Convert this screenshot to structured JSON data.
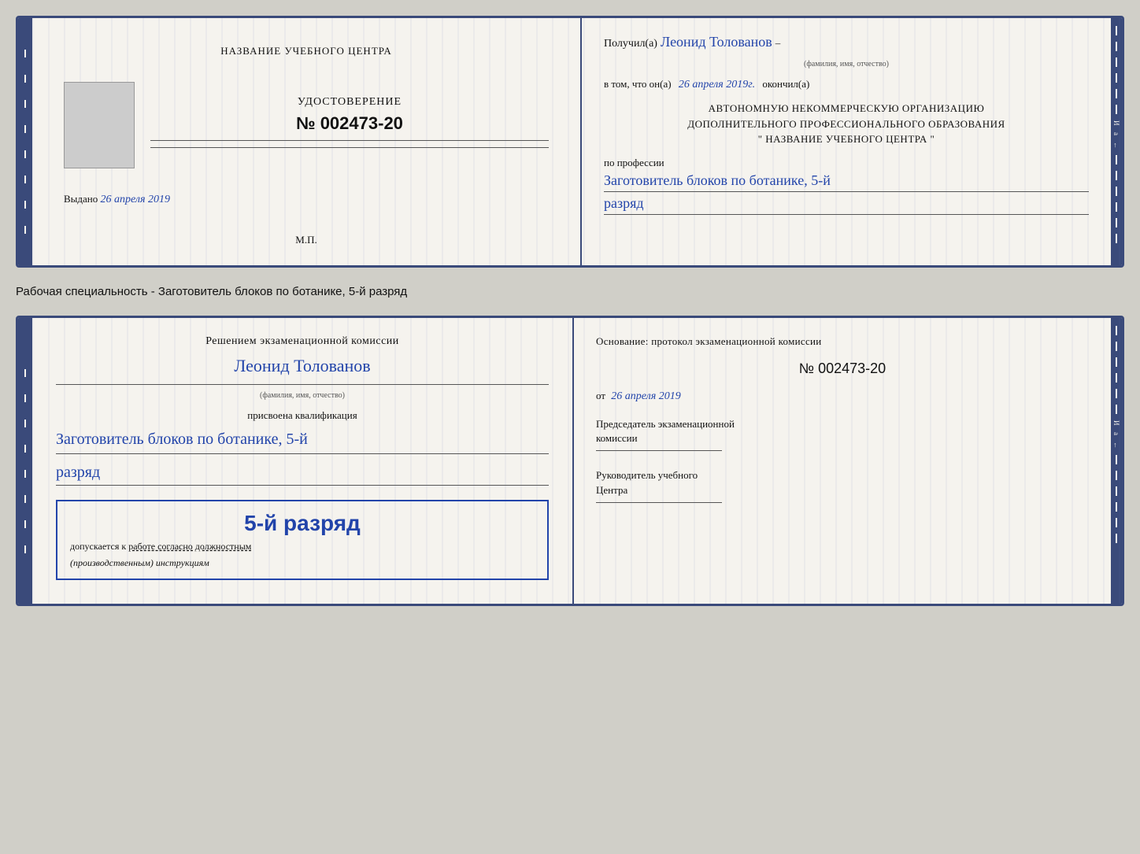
{
  "page": {
    "background_color": "#d0cfc8"
  },
  "top_card": {
    "left": {
      "title": "НАЗВАНИЕ УЧЕБНОГО ЦЕНТРА",
      "udostoverenie_label": "УДОСТОВЕРЕНИЕ",
      "number": "№ 002473-20",
      "vydano_prefix": "Выдано",
      "vydano_date": "26 апреля 2019",
      "mp_label": "М.П."
    },
    "right": {
      "poluchil_prefix": "Получил(а)",
      "fio": "Леонид Толованов",
      "fio_sub": "(фамилия, имя, отчество)",
      "vtom_prefix": "в том, что он(а)",
      "vtom_date": "26 апреля 2019г.",
      "okonchil": "окончил(а)",
      "auto_line1": "АВТОНОМНУЮ НЕКОММЕРЧЕСКУЮ ОРГАНИЗАЦИЮ",
      "auto_line2": "ДОПОЛНИТЕЛЬНОГО ПРОФЕССИОНАЛЬНОГО ОБРАЗОВАНИЯ",
      "auto_line3": "\"  НАЗВАНИЕ УЧЕБНОГО ЦЕНТРА  \"",
      "po_professii": "по профессии",
      "profession": "Заготовитель блоков по ботанике, 5-й",
      "razryad": "разряд"
    }
  },
  "description": "Рабочая специальность - Заготовитель блоков по ботанике, 5-й разряд",
  "bottom_card": {
    "left": {
      "resheniem": "Решением экзаменационной комиссии",
      "fio": "Леонид Толованов",
      "fio_sub": "(фамилия, имя, отчество)",
      "prisvoena": "присвоена квалификация",
      "profession": "Заготовитель блоков по ботанике, 5-й",
      "razryad": "разряд",
      "stamp_text": "5-й разряд",
      "dopuskaetsya": "допускается к",
      "rabote": "работе согласно должностным",
      "instruktsii": "(производственным) инструкциям"
    },
    "right": {
      "osnovanie": "Основание: протокол экзаменационной комиссии",
      "number": "№  002473-20",
      "ot_prefix": "от",
      "ot_date": "26 апреля 2019",
      "predsedatel_line1": "Председатель экзаменационной",
      "predsedatel_line2": "комиссии",
      "rukovoditel_line1": "Руководитель учебного",
      "rukovoditel_line2": "Центра"
    }
  }
}
